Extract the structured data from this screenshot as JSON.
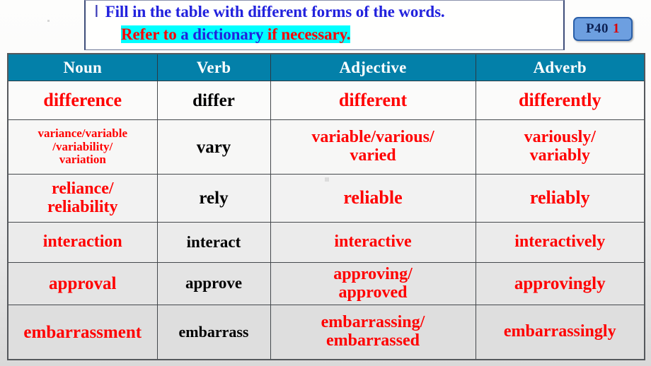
{
  "instruction": {
    "numeral": "Ⅰ",
    "line1": "Fill in the table with different forms of the words.",
    "line2_part1": "Refer to",
    "line2_part2": "a dictionary",
    "line2_part3": "if necessary."
  },
  "badge": {
    "page_label": "P40",
    "number": "1"
  },
  "colors": {
    "header_teal": "#0380a9",
    "answer_red": "#ff0000",
    "prompt_black": "#000000",
    "instruction_blue": "#2222dd",
    "highlight_cyan": "#00ffff",
    "badge_blue": "#6d9fe0",
    "badge_border": "#2a5fa8"
  },
  "table": {
    "columns": [
      "Noun",
      "Verb",
      "Adjective",
      "Adverb"
    ],
    "rows": [
      {
        "noun": "difference",
        "verb": "differ",
        "adjective": "different",
        "adverb": "differently"
      },
      {
        "noun": "variance/variable\n/variability/\nvariation",
        "verb": "vary",
        "adjective": "variable/various/\nvaried",
        "adverb": "variously/\nvariably"
      },
      {
        "noun": "reliance/\nreliability",
        "verb": "rely",
        "adjective": "reliable",
        "adverb": "reliably"
      },
      {
        "noun": "interaction",
        "verb": "interact",
        "adjective": "interactive",
        "adverb": "interactively"
      },
      {
        "noun": "approval",
        "verb": "approve",
        "adjective": "approving/\napproved",
        "adverb": "approvingly"
      },
      {
        "noun": "embarrassment",
        "verb": "embarrass",
        "adjective": "embarrassing/\nembarrassed",
        "adverb": "embarrassingly"
      }
    ]
  }
}
